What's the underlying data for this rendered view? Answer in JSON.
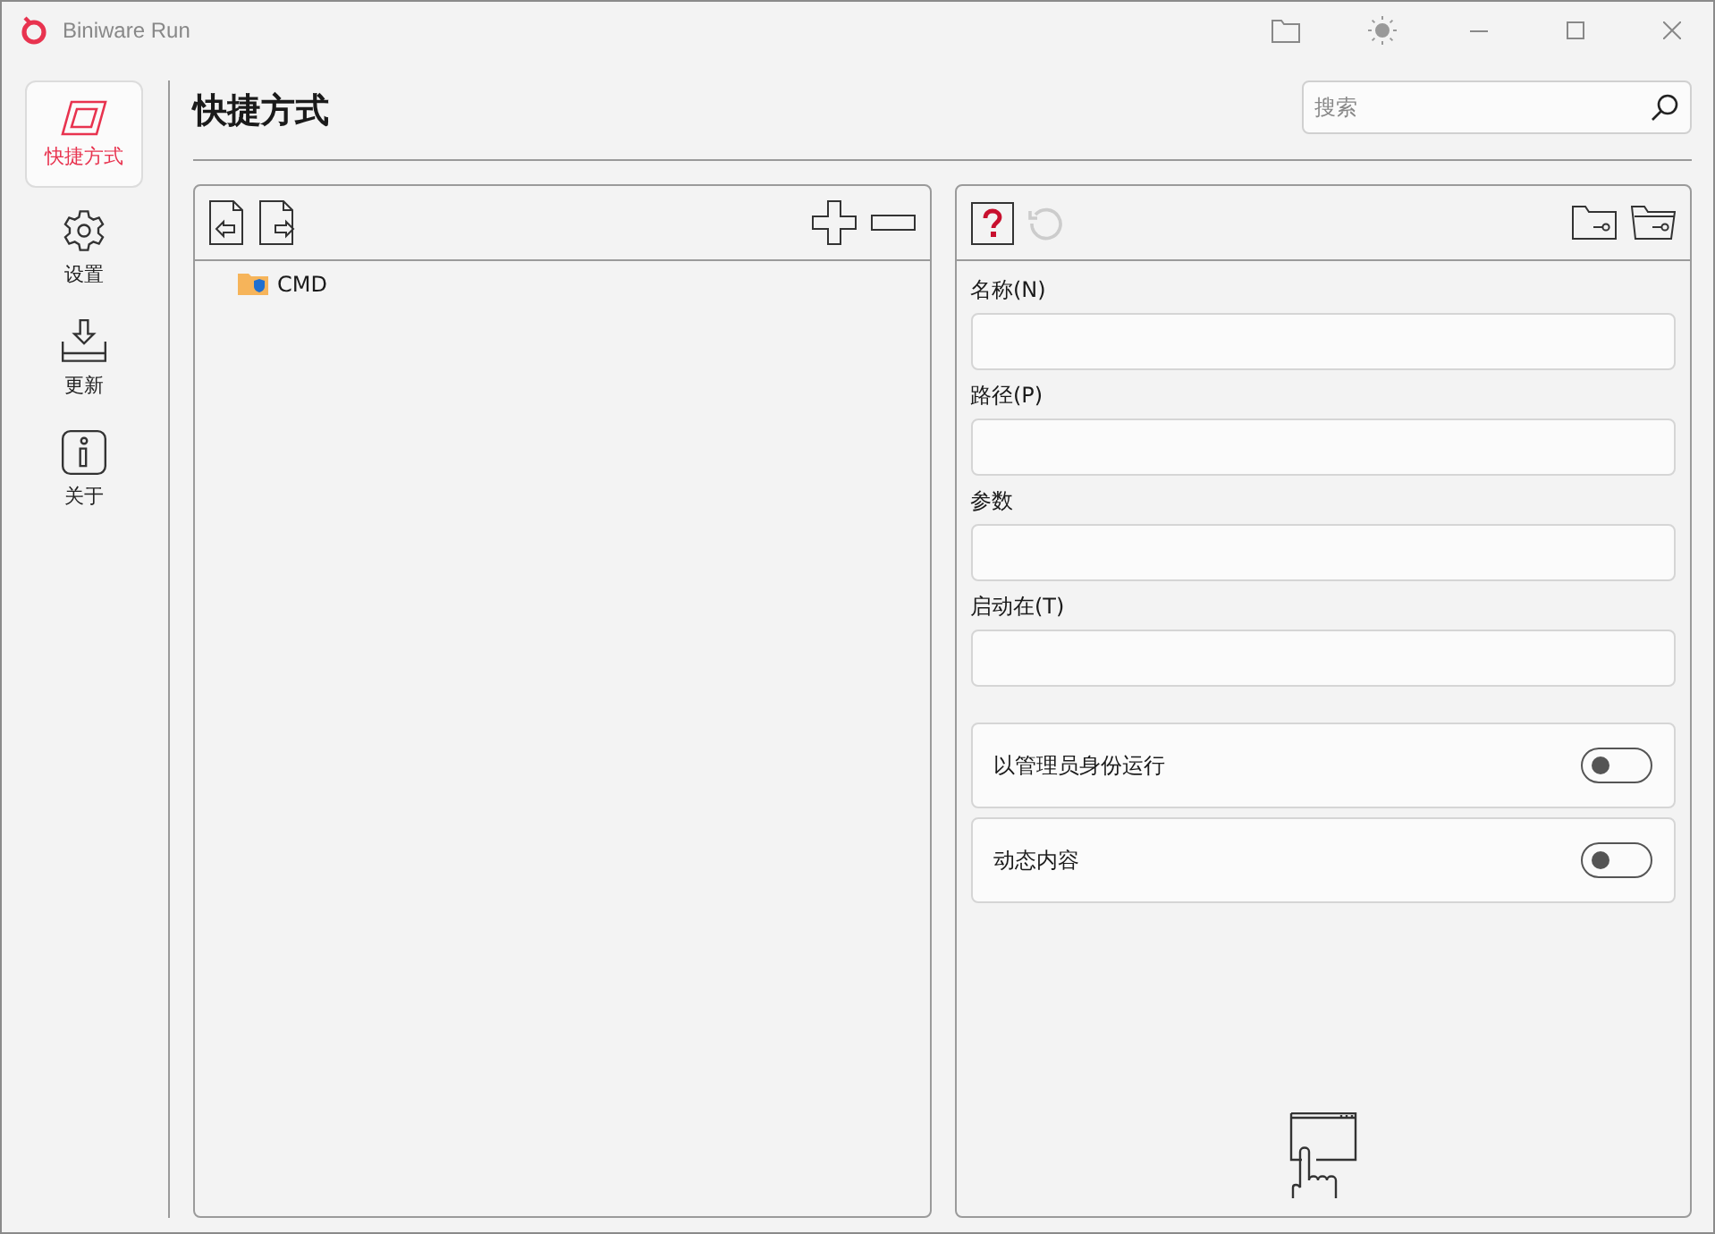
{
  "window": {
    "title": "Biniware Run"
  },
  "sidebar": {
    "items": [
      {
        "label": "快捷方式",
        "kind": "shortcut",
        "selected": true
      },
      {
        "label": "设置",
        "kind": "settings",
        "selected": false
      },
      {
        "label": "更新",
        "kind": "update",
        "selected": false
      },
      {
        "label": "关于",
        "kind": "about",
        "selected": false
      }
    ]
  },
  "page": {
    "title": "快捷方式"
  },
  "search": {
    "placeholder": "搜索"
  },
  "tree": {
    "items": [
      {
        "label": "CMD"
      }
    ]
  },
  "form": {
    "fields": [
      {
        "label": "名称(N)"
      },
      {
        "label": "路径(P)"
      },
      {
        "label": "参数"
      },
      {
        "label": "启动在(T)"
      }
    ],
    "toggles": [
      {
        "label": "以管理员身份运行",
        "on": false
      },
      {
        "label": "动态内容",
        "on": false
      }
    ]
  }
}
